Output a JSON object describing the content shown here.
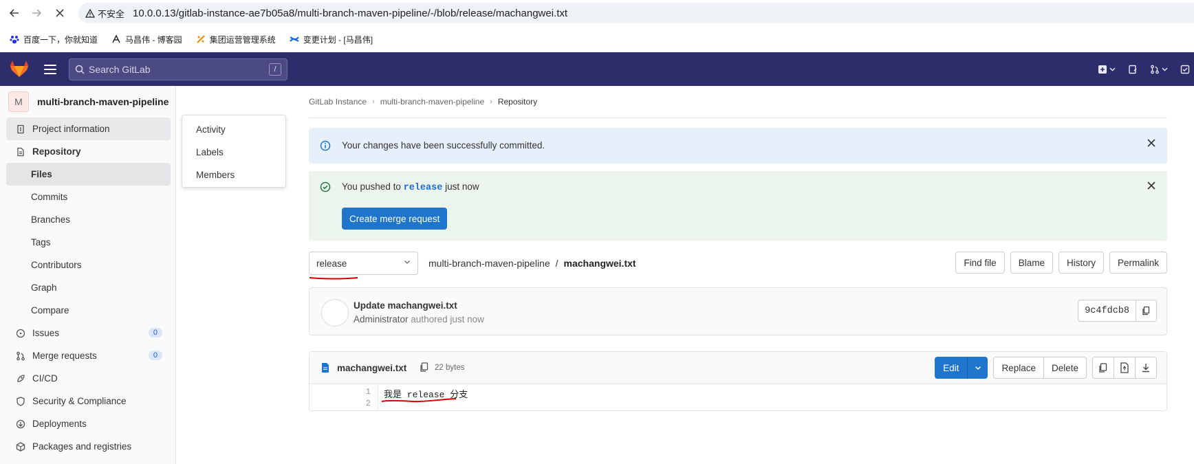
{
  "browser": {
    "insecure_label": "不安全",
    "url": "10.0.0.13/gitlab-instance-ae7b05a8/multi-branch-maven-pipeline/-/blob/release/machangwei.txt",
    "bookmarks": [
      {
        "label": "百度一下，你就知道",
        "icon": "baidu-icon"
      },
      {
        "label": "马昌伟 - 博客园",
        "icon": "cnblogs-icon"
      },
      {
        "label": "集团运营管理系统",
        "icon": "ops-icon"
      },
      {
        "label": "变更计划 - [马昌伟]",
        "icon": "confluence-icon"
      }
    ]
  },
  "topbar": {
    "search_placeholder": "Search GitLab",
    "search_shortcut": "/"
  },
  "sidebar": {
    "project_initial": "M",
    "project_name": "multi-branch-maven-pipeline",
    "items": [
      {
        "label": "Project information",
        "icon": "info-icon"
      },
      {
        "label": "Repository",
        "icon": "document-icon"
      },
      {
        "label": "Files"
      },
      {
        "label": "Commits"
      },
      {
        "label": "Branches"
      },
      {
        "label": "Tags"
      },
      {
        "label": "Contributors"
      },
      {
        "label": "Graph"
      },
      {
        "label": "Compare"
      },
      {
        "label": "Issues",
        "icon": "issues-icon",
        "count": "0"
      },
      {
        "label": "Merge requests",
        "icon": "merge-request-icon",
        "count": "0"
      },
      {
        "label": "CI/CD",
        "icon": "rocket-icon"
      },
      {
        "label": "Security & Compliance",
        "icon": "shield-icon"
      },
      {
        "label": "Deployments",
        "icon": "deployments-icon"
      },
      {
        "label": "Packages and registries",
        "icon": "package-icon"
      }
    ],
    "flyout": [
      "Activity",
      "Labels",
      "Members"
    ]
  },
  "breadcrumb": [
    "GitLab Instance",
    "multi-branch-maven-pipeline",
    "Repository"
  ],
  "alerts": {
    "info": "Your changes have been successfully committed.",
    "success_prefix": "You pushed to",
    "success_branch": "release",
    "success_suffix": "just now",
    "merge_button": "Create merge request"
  },
  "file_nav": {
    "branch": "release",
    "repo": "multi-branch-maven-pipeline",
    "separator": "/",
    "file": "machangwei.txt",
    "buttons": [
      "Find file",
      "Blame",
      "History",
      "Permalink"
    ]
  },
  "commit": {
    "title": "Update machangwei.txt",
    "author": "Administrator",
    "authored": "authored just now",
    "sha": "9c4fdcb8"
  },
  "file": {
    "name": "machangwei.txt",
    "size": "22 bytes",
    "edit": "Edit",
    "replace": "Replace",
    "delete": "Delete",
    "lines": [
      "我是 release 分支",
      ""
    ],
    "line_numbers": [
      "1",
      "2"
    ]
  },
  "colors": {
    "topbar": "#2e2d6b",
    "primary": "#1f75cb",
    "info_bg": "#e6f0fb",
    "success_bg": "#ecf4ee",
    "annotation": "#d40000"
  }
}
